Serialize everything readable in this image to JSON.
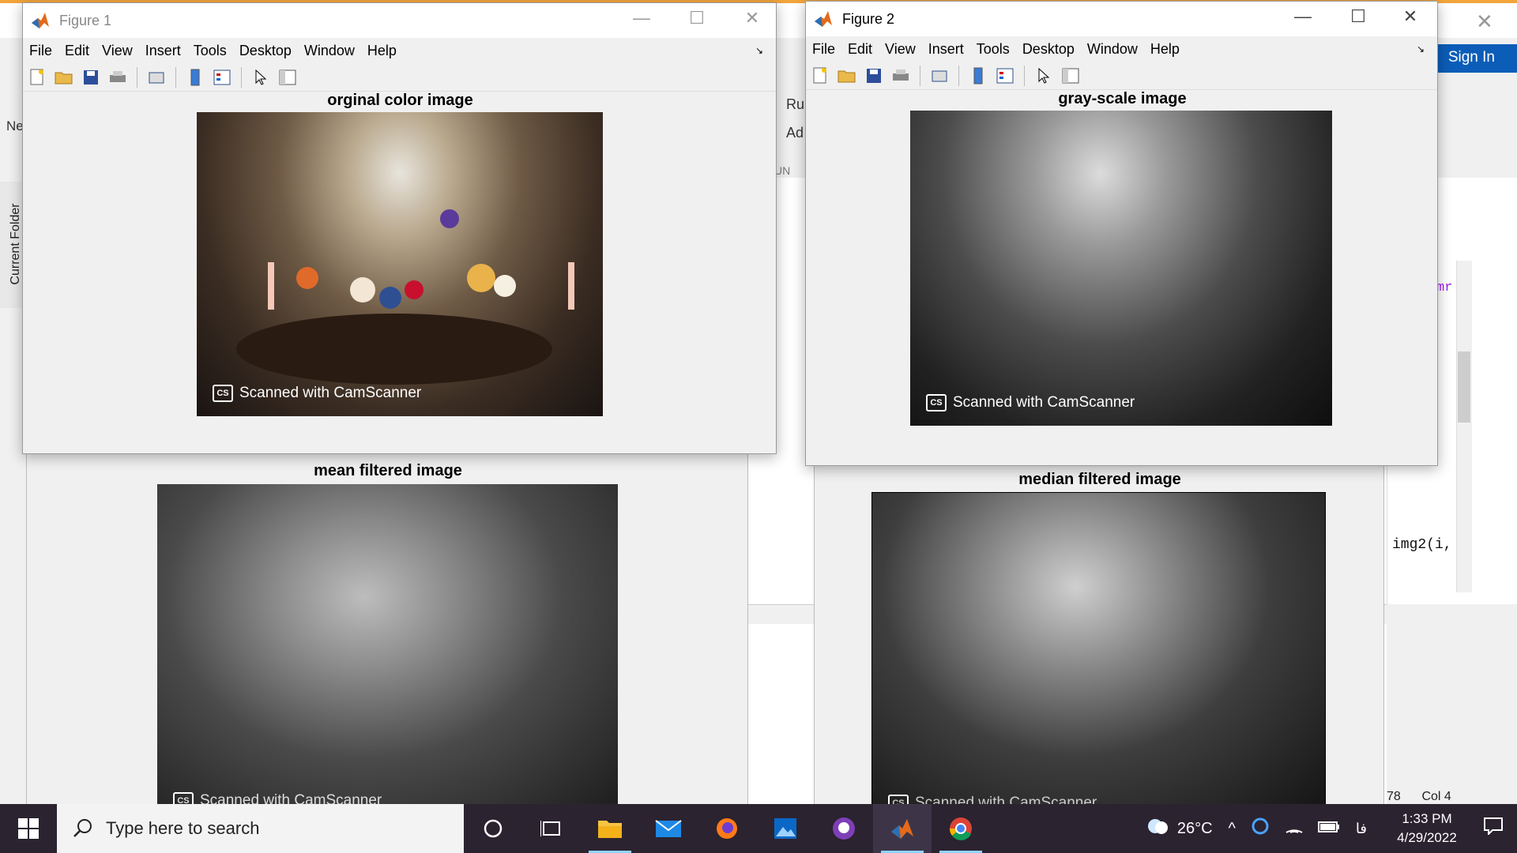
{
  "figure1": {
    "title": "Figure 1",
    "menu": [
      "File",
      "Edit",
      "View",
      "Insert",
      "Tools",
      "Desktop",
      "Window",
      "Help"
    ],
    "axes_title": "orginal color image",
    "watermark": "Scanned with CamScanner",
    "watermark_logo": "CS"
  },
  "figure2": {
    "title": "Figure 2",
    "menu": [
      "File",
      "Edit",
      "View",
      "Insert",
      "Tools",
      "Desktop",
      "Window",
      "Help"
    ],
    "axes_title": "gray-scale image",
    "watermark": "Scanned with CamScanner",
    "watermark_logo": "CS"
  },
  "figure3": {
    "axes_title": "mean filtered image",
    "watermark": "Scanned with CamScanner"
  },
  "figure4": {
    "axes_title": "median filtered image",
    "watermark": "Scanned with CamScanner"
  },
  "background": {
    "sign_in": "Sign In",
    "current_folder": "Current Folder",
    "ne": "Ne",
    "ru": "Ru",
    "ad": "Ad",
    "run_section": "UN",
    "code_line": "img2(i,",
    "code_frag": "mr",
    "status_line": "78",
    "status_col": "Col  4"
  },
  "taskbar": {
    "search_placeholder": "Type here to search",
    "weather": "26°C",
    "lang": "فا",
    "time": "1:33 PM",
    "date": "4/29/2022"
  },
  "colors": {
    "matlab_orange": "#f3a53b",
    "signin_blue": "#0c5db8",
    "taskbar": "#2b2330"
  }
}
